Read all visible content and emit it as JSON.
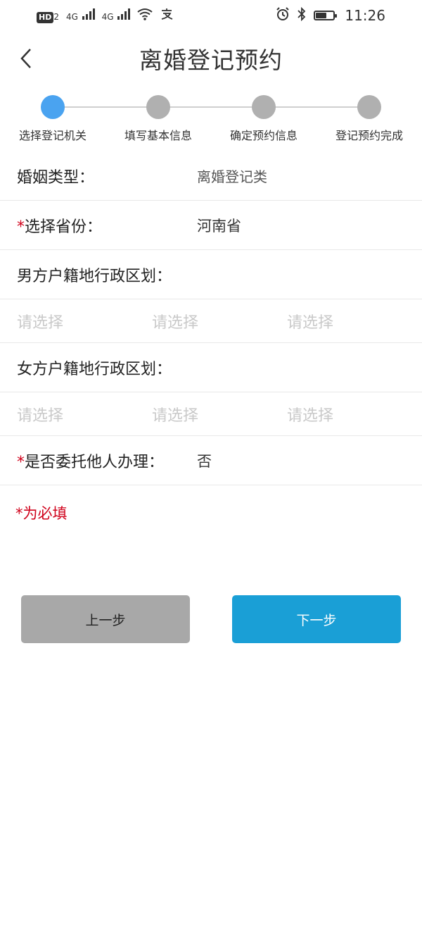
{
  "status": {
    "hd_badge": "HD",
    "hd_sub": "2",
    "net1": "4G",
    "net2": "4G",
    "time": "11:26"
  },
  "header": {
    "title": "离婚登记预约"
  },
  "steps": [
    {
      "label": "选择登记机关",
      "active": true
    },
    {
      "label": "填写基本信息",
      "active": false
    },
    {
      "label": "确定预约信息",
      "active": false
    },
    {
      "label": "登记预约完成",
      "active": false
    }
  ],
  "form": {
    "marriage_type_label": "婚姻类型：",
    "marriage_type_value": "离婚登记类",
    "province_label": "选择省份：",
    "province_value": "河南省",
    "male_region_label": "男方户籍地行政区划：",
    "male_picks": [
      "请选择",
      "请选择",
      "请选择"
    ],
    "female_region_label": "女方户籍地行政区划：",
    "female_picks": [
      "请选择",
      "请选择",
      "请选择"
    ],
    "delegate_label": "是否委托他人办理：",
    "delegate_value": "否",
    "required_mark": "*",
    "required_note": "*为必填"
  },
  "buttons": {
    "prev": "上一步",
    "next": "下一步"
  },
  "colors": {
    "accent": "#1a9fd6",
    "step_active": "#4aa3f0",
    "step_inactive": "#b0b0b0",
    "required": "#d0021b"
  }
}
